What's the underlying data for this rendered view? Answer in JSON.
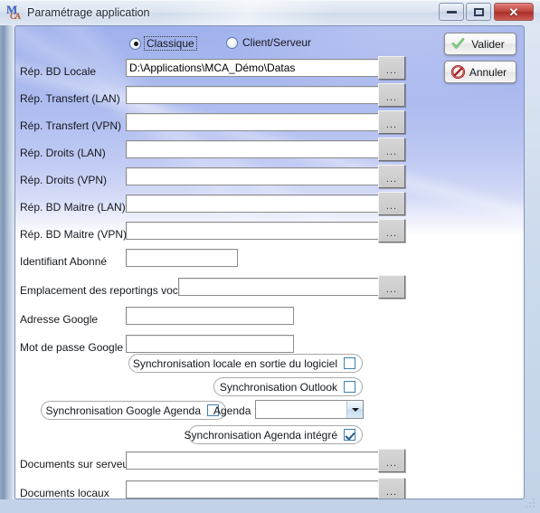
{
  "window": {
    "title": "Paramétrage application",
    "icon": "mca-app-icon",
    "controls": {
      "minimize": "minimize-icon",
      "maximize": "maximize-icon",
      "close": "✕"
    }
  },
  "mode_selector": {
    "options": [
      {
        "label": "Classique",
        "selected": true
      },
      {
        "label": "Client/Serveur",
        "selected": false
      }
    ]
  },
  "actions": {
    "validate": {
      "label": "Valider",
      "icon": "green-check-icon",
      "color": "#4ba84b"
    },
    "cancel": {
      "label": "Annuler",
      "icon": "red-forbidden-icon",
      "color": "#b32020"
    }
  },
  "fields": [
    {
      "label": "Rép. BD Locale",
      "value": "D:\\Applications\\MCA_Démo\\Datas",
      "browse": "..."
    },
    {
      "label": "Rép. Transfert (LAN)",
      "value": "",
      "browse": "..."
    },
    {
      "label": "Rép. Transfert (VPN)",
      "value": "",
      "browse": "..."
    },
    {
      "label": "Rép. Droits (LAN)",
      "value": "",
      "browse": "..."
    },
    {
      "label": "Rép. Droits (VPN)",
      "value": "",
      "browse": "..."
    },
    {
      "label": "Rép. BD Maitre (LAN)",
      "value": "",
      "browse": "..."
    },
    {
      "label": "Rép. BD Maitre (VPN)",
      "value": "",
      "browse": "..."
    }
  ],
  "identifiant": {
    "label": "Identifiant Abonné",
    "value": ""
  },
  "reportings": {
    "label": "Emplacement des reportings vocaux",
    "value": "",
    "browse": "..."
  },
  "google": {
    "address": {
      "label": "Adresse Google",
      "value": ""
    },
    "password": {
      "label": "Mot de passe Google",
      "value": ""
    }
  },
  "sync": {
    "local_exit": {
      "label": "Synchronisation locale en sortie du logiciel",
      "checked": false
    },
    "outlook": {
      "label": "Synchronisation Outlook",
      "checked": false
    },
    "google_agenda": {
      "label": "Synchronisation Google Agenda",
      "checked": false
    },
    "agenda_label": "Agenda",
    "agenda_value": "",
    "agenda_options": [],
    "integrated_agenda": {
      "label": "Synchronisation Agenda intégré",
      "checked": true
    }
  },
  "documents": {
    "server": {
      "label": "Documents sur serveur",
      "value": "",
      "browse": "..."
    },
    "local": {
      "label": "Documents locaux",
      "value": "",
      "browse": "..."
    }
  }
}
